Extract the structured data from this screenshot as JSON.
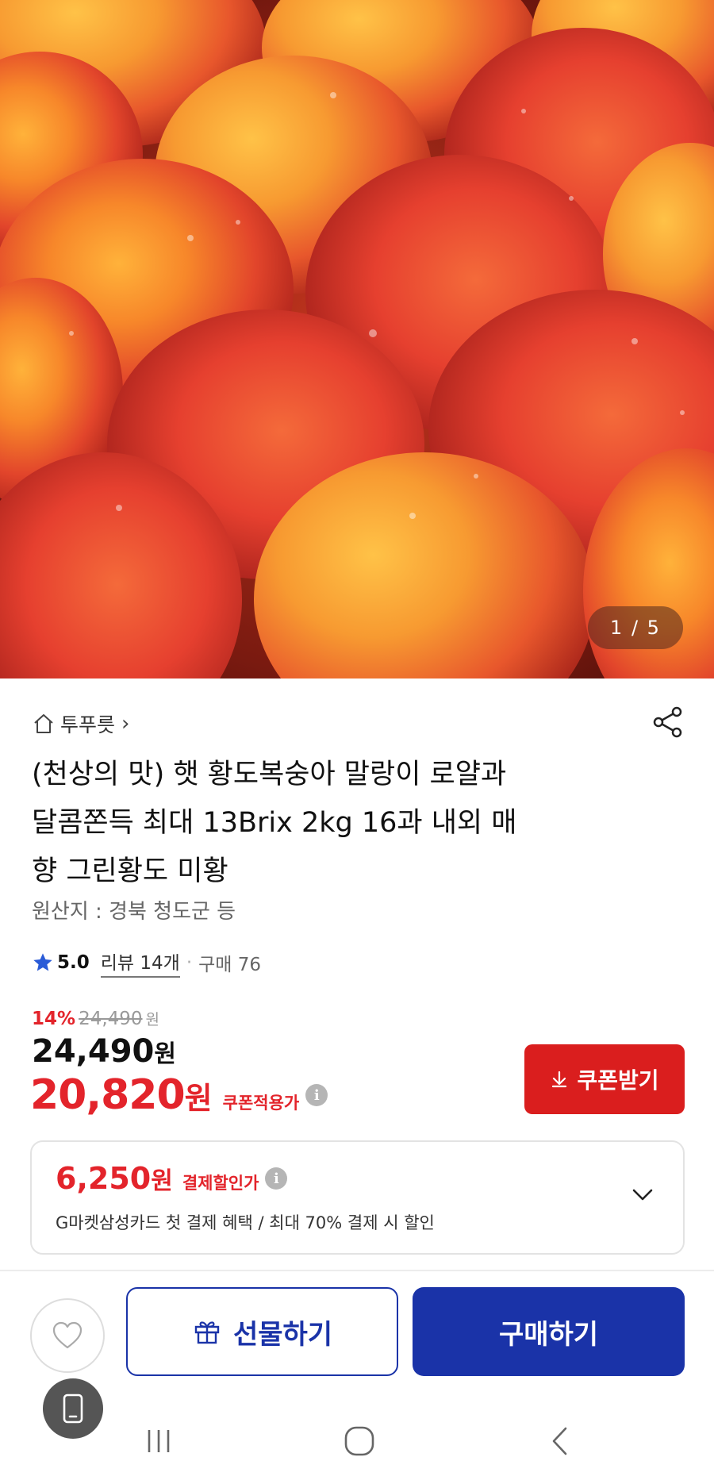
{
  "hero": {
    "page_counter": "1 / 5",
    "image_alt": "peaches"
  },
  "seller": {
    "name": "투푸릇",
    "chevron": "›"
  },
  "product": {
    "title_line1": "(천상의 맛) 햇 황도복숭아 말랑이 로얄과",
    "title_line2": "달콤쫀득 최대 13Brix 2kg 16과 내외 매",
    "title_line3": "향 그린황도 미황",
    "origin": "원산지 : 경북 청도군 등"
  },
  "rating": {
    "value": "5.0",
    "review_link": "리뷰 14개",
    "separator": "·",
    "purchase_count": "구매 76"
  },
  "price": {
    "discount_rate": "14%",
    "original_price": "24,490",
    "original_unit": "원",
    "sale_price": "24,490",
    "sale_unit": "원",
    "coupon_price": "20,820",
    "coupon_unit": "원",
    "coupon_label": "쿠폰적용가",
    "info_glyph": "i"
  },
  "coupon_button": {
    "label": "쿠폰받기"
  },
  "payment_discount": {
    "amount": "6,250",
    "unit": "원",
    "label": "결제할인가",
    "description": "G마켓삼성카드 첫 결제 혜택 / 최대 70% 결제 시 할인"
  },
  "action_bar": {
    "gift_label": "선물하기",
    "buy_label": "구매하기"
  },
  "colors": {
    "accent_red": "#e3242b",
    "coupon_button": "#da1e1e",
    "primary_blue": "#1a33a8"
  },
  "icons": [
    "home-icon",
    "share-icon",
    "star-icon",
    "info-icon",
    "download-icon",
    "chevron-down-icon",
    "heart-icon",
    "gift-icon",
    "phone-icon",
    "recents-icon",
    "home-nav-icon",
    "back-icon"
  ]
}
